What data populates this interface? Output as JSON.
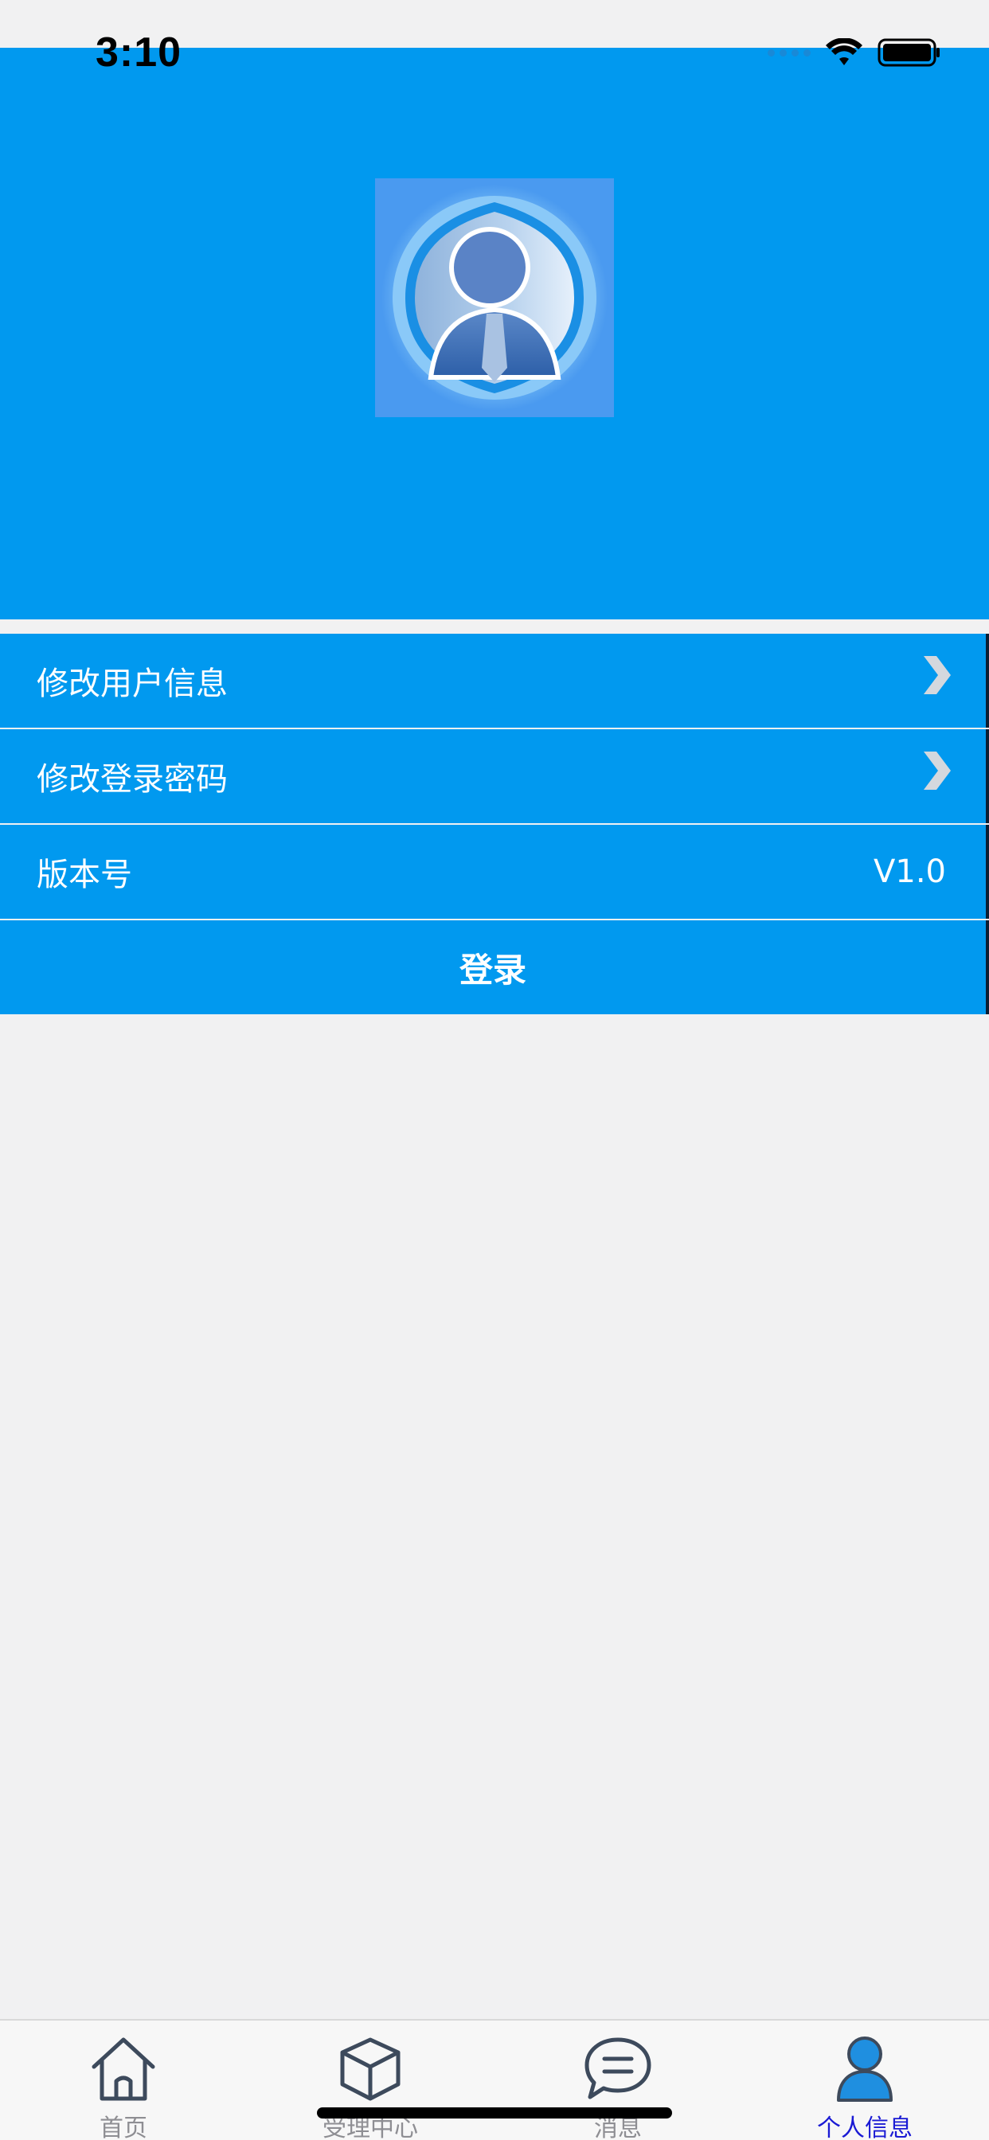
{
  "status_bar": {
    "time": "3:10"
  },
  "menu": {
    "items": [
      {
        "label": "修改用户信息",
        "has_arrow": true
      },
      {
        "label": "修改登录密码",
        "has_arrow": true
      },
      {
        "label": "版本号",
        "value": "V1.0"
      }
    ],
    "login_label": "登录"
  },
  "tabbar": {
    "tabs": [
      {
        "label": "首页",
        "icon": "home-icon"
      },
      {
        "label": "受理中心",
        "icon": "box-icon"
      },
      {
        "label": "消息",
        "icon": "message-icon"
      },
      {
        "label": "个人信息",
        "icon": "person-icon",
        "active": true
      }
    ]
  },
  "colors": {
    "accent_blue": "#0199ef",
    "active_tab": "#1a1ad4",
    "inactive_tab": "#8e8e93",
    "background": "#f1f1f2"
  }
}
